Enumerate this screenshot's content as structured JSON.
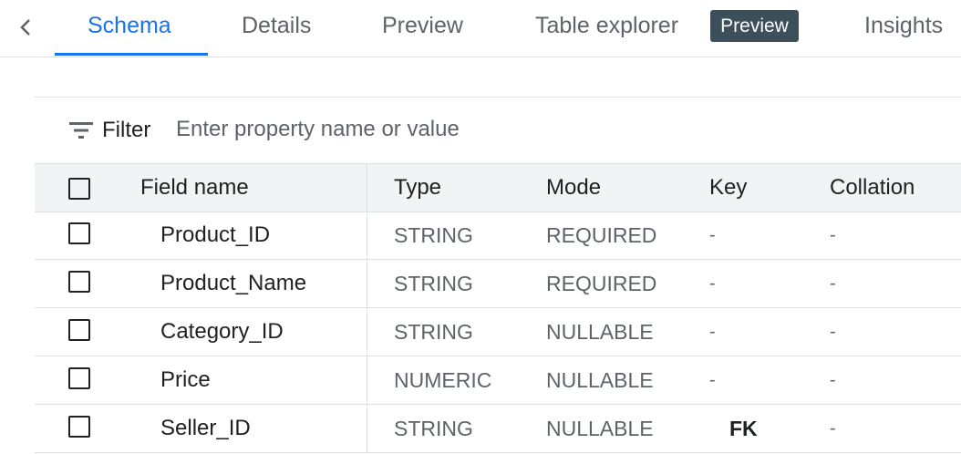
{
  "tabs": {
    "items": [
      {
        "label": "Schema",
        "active": true
      },
      {
        "label": "Details"
      },
      {
        "label": "Preview"
      },
      {
        "label": "Table explorer"
      },
      {
        "label": "Insights"
      }
    ],
    "badge": "Preview"
  },
  "filter": {
    "label": "Filter",
    "placeholder": "Enter property name or value"
  },
  "table": {
    "headers": {
      "field_name": "Field name",
      "type": "Type",
      "mode": "Mode",
      "key": "Key",
      "collation": "Collation"
    },
    "rows": [
      {
        "name": "Product_ID",
        "type": "STRING",
        "mode": "REQUIRED",
        "key": "-",
        "collation": "-"
      },
      {
        "name": "Product_Name",
        "type": "STRING",
        "mode": "REQUIRED",
        "key": "-",
        "collation": "-"
      },
      {
        "name": "Category_ID",
        "type": "STRING",
        "mode": "NULLABLE",
        "key": "-",
        "collation": "-"
      },
      {
        "name": "Price",
        "type": "NUMERIC",
        "mode": "NULLABLE",
        "key": "-",
        "collation": "-"
      },
      {
        "name": "Seller_ID",
        "type": "STRING",
        "mode": "NULLABLE",
        "key": "FK",
        "collation": "-"
      }
    ]
  },
  "colors": {
    "accent": "#1a73e8",
    "badge_bg": "#3c4f5a",
    "header_bg": "#f1f3f4"
  }
}
